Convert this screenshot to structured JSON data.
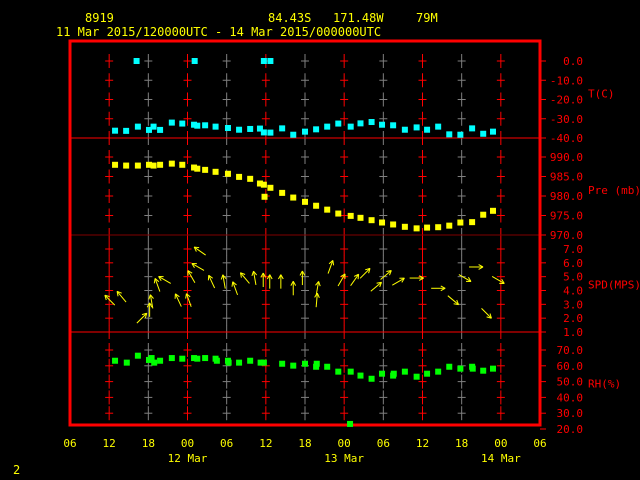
{
  "header": {
    "station": "8919",
    "lat": "84.43S",
    "lon": "171.48W",
    "elev": "79M",
    "period": "11 Mar 2015/120000UTC - 14 Mar 2015/000000UTC"
  },
  "footer": {
    "page": "2"
  },
  "colors": {
    "frame": "#ff0000",
    "temp": "#00ffff",
    "pres": "#ffff00",
    "wind": "#ffff00",
    "rh": "#00ff00",
    "grid_alt": "#808080",
    "text": "#ffff00"
  },
  "chart_data": {
    "type": "scatter",
    "x_unit": "hours since 11 Mar 06UTC",
    "xlim": [
      0,
      72
    ],
    "x_ticks": [
      "06",
      "12",
      "18",
      "00",
      "06",
      "12",
      "18",
      "00",
      "06",
      "12",
      "18",
      "00",
      "06"
    ],
    "x_date_labels": [
      {
        "label": "12 Mar",
        "hour": 18
      },
      {
        "label": "13 Mar",
        "hour": 42
      },
      {
        "label": "14 Mar",
        "hour": 66
      }
    ],
    "panels": [
      {
        "name": "temp",
        "label": "T(C)",
        "ylim": [
          -40,
          0
        ],
        "ticks": [
          "0.0",
          "-10.0",
          "-20.0",
          "-30.0",
          "-40.0"
        ],
        "x": [
          6.9,
          8.6,
          10.4,
          12.1,
          12.8,
          13.8,
          15.6,
          17.2,
          19,
          19.5,
          20.7,
          22.3,
          24.2,
          25.9,
          27.6,
          29.1,
          29.7,
          30.7,
          32.5,
          34.2,
          36,
          37.7,
          39.4,
          41.1,
          43,
          44.5,
          46.2,
          47.8,
          49.5,
          51.3,
          53.1,
          54.7,
          56.4,
          58.1,
          59.8,
          61.6,
          63.3,
          64.8,
          10.2,
          19.1,
          29.7,
          30.7
        ],
        "y": [
          -36.2,
          -36.3,
          -34.1,
          -35.8,
          -34.1,
          -35.8,
          -32.0,
          -32.5,
          -33.1,
          -33.6,
          -33.4,
          -34.1,
          -34.8,
          -35.7,
          -35.3,
          -35.1,
          -37.1,
          -37.2,
          -35.0,
          -38.3,
          -36.7,
          -35.5,
          -34.1,
          -32.5,
          -34.1,
          -32.4,
          -31.7,
          -33.1,
          -33.4,
          -35.7,
          -34.5,
          -35.7,
          -34.1,
          -38.1,
          -38.3,
          -35.0,
          -37.8,
          -36.7,
          0,
          0,
          0,
          0
        ]
      },
      {
        "name": "pres",
        "label": "Pre (mb)",
        "ylim": [
          970,
          990
        ],
        "ticks": [
          "990.0",
          "985.0",
          "980.0",
          "975.0",
          "970.0"
        ],
        "x": [
          6.9,
          8.6,
          10.4,
          12.1,
          12.8,
          13.8,
          15.6,
          17.2,
          19,
          19.5,
          20.7,
          22.3,
          24.2,
          25.9,
          27.6,
          29.1,
          29.7,
          29.8,
          30.7,
          32.5,
          34.2,
          36,
          37.7,
          39.4,
          41.1,
          43,
          44.5,
          46.2,
          47.8,
          49.5,
          51.3,
          53.1,
          54.7,
          56.4,
          58.1,
          59.8,
          61.6,
          63.3,
          64.8
        ],
        "y": [
          988.0,
          987.8,
          987.8,
          988.0,
          987.8,
          988.0,
          988.3,
          988.0,
          987.3,
          987.0,
          986.7,
          986.2,
          985.7,
          984.9,
          984.4,
          983.2,
          982.9,
          979.8,
          982.1,
          980.8,
          979.6,
          978.5,
          977.5,
          976.5,
          975.5,
          974.9,
          974.4,
          973.8,
          973.2,
          972.7,
          972.1,
          971.7,
          971.9,
          972.0,
          972.4,
          973.2,
          973.3,
          975.2,
          976.2
        ]
      },
      {
        "name": "wind",
        "label": "SPD(MPS)",
        "ylim": [
          1,
          7
        ],
        "ticks": [
          "7.0",
          "6.0",
          "5.0",
          "4.0",
          "3.0",
          "2.0",
          "1.0"
        ],
        "x": [
          6.1,
          7.9,
          11,
          12.2,
          12.5,
          13.4,
          14.5,
          16.6,
          18.2,
          19.9,
          19.6,
          18.6,
          21.7,
          23.6,
          25.3,
          26.8,
          28.3,
          29.6,
          30.6,
          32.3,
          34.2,
          35.6,
          37.9,
          37.8,
          39.9,
          41.6,
          43.6,
          45.2,
          46.9,
          48.4,
          50.3,
          53.1,
          56.4,
          58.7,
          60.5,
          62.2,
          65.6,
          63.8
        ],
        "y": [
          3.3,
          3.55,
          2.0,
          2.6,
          3.2,
          4.4,
          4.76,
          3.3,
          3.3,
          6.85,
          5.7,
          5.0,
          4.64,
          4.64,
          4.16,
          4.9,
          4.9,
          4.76,
          4.64,
          4.64,
          4.16,
          4.9,
          4.16,
          3.3,
          5.7,
          4.76,
          4.76,
          5.24,
          4.27,
          5.12,
          4.64,
          4.9,
          4.16,
          3.3,
          4.9,
          5.7,
          4.76,
          2.35
        ],
        "dir_deg": [
          135,
          130,
          45,
          90,
          100,
          110,
          150,
          115,
          110,
          145,
          150,
          120,
          115,
          100,
          110,
          130,
          100,
          90,
          90,
          90,
          90,
          90,
          80,
          85,
          70,
          60,
          55,
          45,
          40,
          40,
          30,
          0,
          0,
          -40,
          -30,
          0,
          -30,
          -45
        ]
      },
      {
        "name": "rh",
        "label": "RH(%)",
        "ylim": [
          20,
          70
        ],
        "ticks": [
          "70.0",
          "60.0",
          "50.0",
          "40.0",
          "30.0",
          "20.0"
        ],
        "x": [
          6.9,
          8.7,
          10.4,
          12.1,
          12.5,
          12.9,
          13.8,
          15.6,
          17.2,
          19,
          19.5,
          20.7,
          22.3,
          22.5,
          24.2,
          24.3,
          25.9,
          27.6,
          29.2,
          29.7,
          32.5,
          34.2,
          36,
          37.7,
          37.8,
          39.4,
          41.1,
          43,
          44.5,
          46.2,
          47.8,
          49.5,
          49.6,
          51.3,
          53.1,
          54.7,
          56.4,
          58.1,
          59.8,
          61.6,
          61.7,
          63.3,
          64.8,
          42.9
        ],
        "y": [
          63.2,
          62.0,
          66.4,
          63.7,
          64.9,
          62.0,
          63.2,
          64.9,
          64.5,
          64.9,
          64.5,
          64.9,
          64.5,
          63.2,
          63.2,
          62.0,
          62.0,
          63.2,
          62.0,
          62.0,
          61.3,
          60.1,
          61.3,
          59.4,
          61.3,
          59.4,
          56.3,
          56.3,
          53.8,
          51.8,
          55.0,
          53.8,
          55.0,
          56.3,
          53.1,
          55.0,
          56.3,
          59.4,
          58.2,
          59.4,
          58.2,
          56.9,
          58.2,
          23.2
        ]
      }
    ]
  }
}
